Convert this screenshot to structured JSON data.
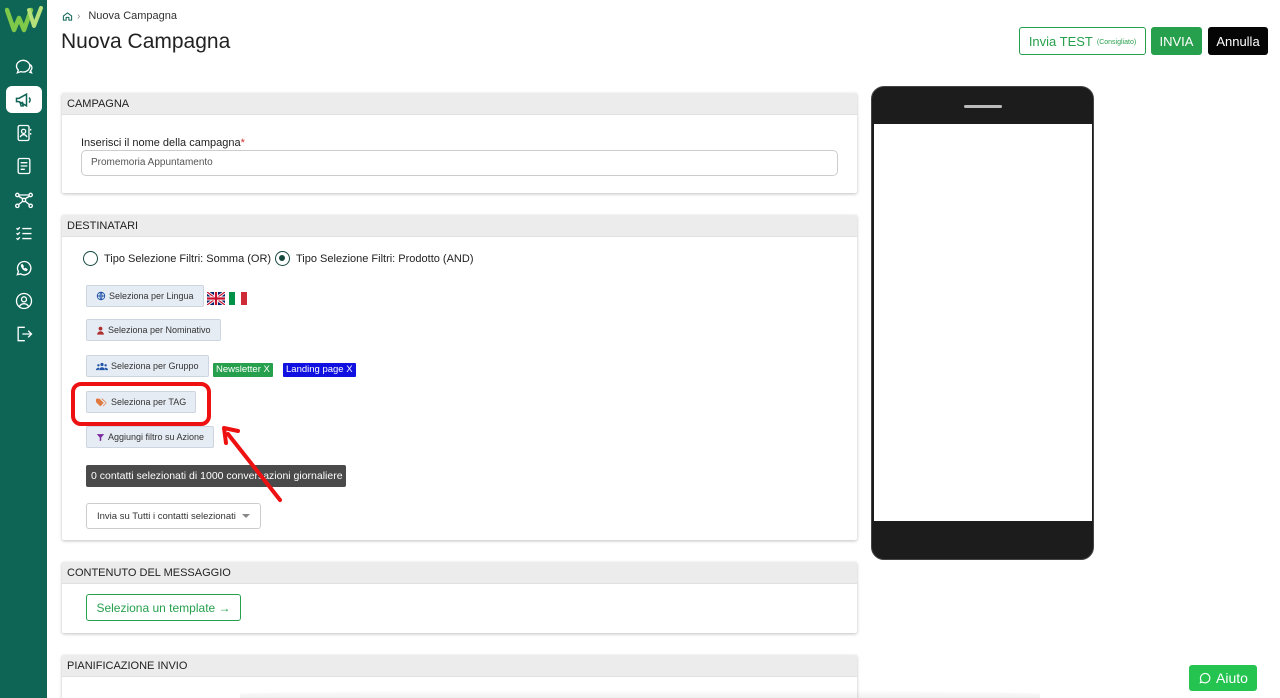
{
  "breadcrumb": {
    "current": "Nuova Campagna"
  },
  "header": {
    "title": "Nuova Campagna",
    "test_label": "Invia TEST",
    "test_note": "(Consigliato)",
    "send_label": "INVIA",
    "cancel_label": "Annulla"
  },
  "sidebar": {
    "items": [
      {
        "icon": "chat-icon"
      },
      {
        "icon": "megaphone-icon",
        "active": true
      },
      {
        "icon": "contacts-icon"
      },
      {
        "icon": "document-icon"
      },
      {
        "icon": "flow-icon"
      },
      {
        "icon": "checklist-icon"
      },
      {
        "icon": "whatsapp-icon"
      },
      {
        "icon": "user-circle-icon"
      },
      {
        "icon": "logout-icon"
      }
    ]
  },
  "campagna": {
    "header": "CAMPAGNA",
    "name_label": "Inserisci il nome della campagna",
    "name_required": "*",
    "name_value": "Promemoria Appuntamento"
  },
  "destinatari": {
    "header": "DESTINATARI",
    "radio_or": "Tipo Selezione Filtri: Somma (OR)",
    "radio_and": "Tipo Selezione Filtri: Prodotto (AND)",
    "selected_radio": "AND",
    "btn_lingua": "Seleziona per Lingua",
    "btn_nominativo": "Seleziona per Nominativo",
    "btn_gruppo": "Seleziona per Gruppo",
    "btn_tag": "Seleziona per TAG",
    "btn_azione": "Aggiungi filtro su Azione",
    "tags": [
      {
        "label": "Newsletter X",
        "color": "#27a04e"
      },
      {
        "label": "Landing page X",
        "color": "#1010e0"
      }
    ],
    "tooltip": "0 contatti selezionati di 1000 conversazioni giornaliere",
    "send_option": "Invia su Tutti i contatti selezionati"
  },
  "contenuto": {
    "header": "CONTENUTO DEL MESSAGGIO",
    "template_btn": "Seleziona un template →"
  },
  "pianificazione": {
    "header": "PIANIFICAZIONE INVIO"
  },
  "help": {
    "label": "Aiuto"
  },
  "colors": {
    "sidebar": "#0e6555",
    "accent": "#27a04e",
    "highlight": "#ee1111"
  }
}
